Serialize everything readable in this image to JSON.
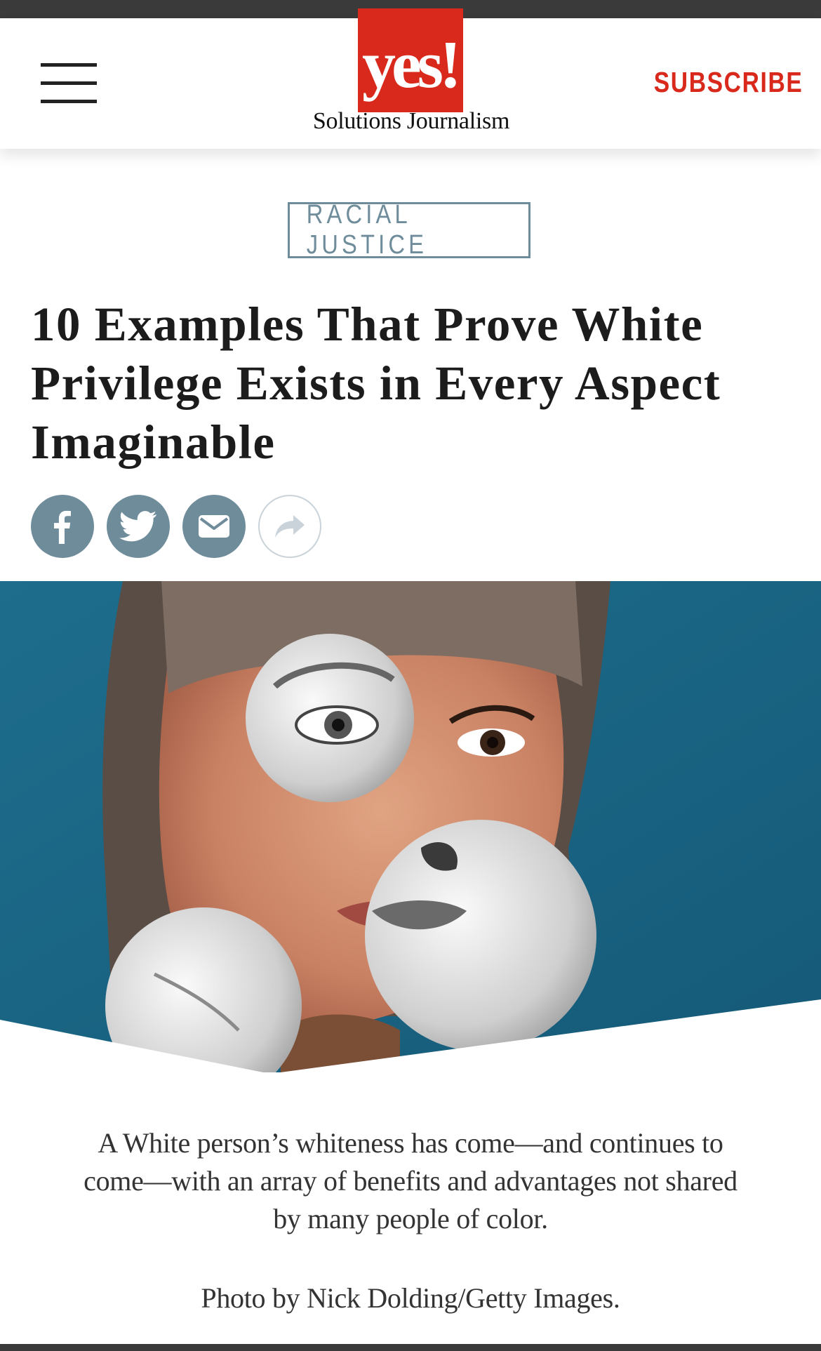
{
  "header": {
    "logo_mark": "yes!",
    "logo_tagline": "Solutions Journalism",
    "subscribe_label": "SUBSCRIBE",
    "menu_icon": "hamburger-menu-icon",
    "brand_color": "#d9291c"
  },
  "article": {
    "category": "RACIAL JUSTICE",
    "title": "10 Examples That Prove White Privilege Exists in Every Aspect Imaginable",
    "share": [
      {
        "icon": "facebook-icon"
      },
      {
        "icon": "twitter-icon"
      },
      {
        "icon": "email-icon"
      },
      {
        "icon": "share-arrow-icon"
      }
    ],
    "dek": "A White person’s whiteness has come—and continues to come—with an array of benefits and advantages not shared by many people of color.",
    "photo_credit": "Photo by Nick Dolding/Getty Images.",
    "accent_color": "#6f8c9b"
  }
}
